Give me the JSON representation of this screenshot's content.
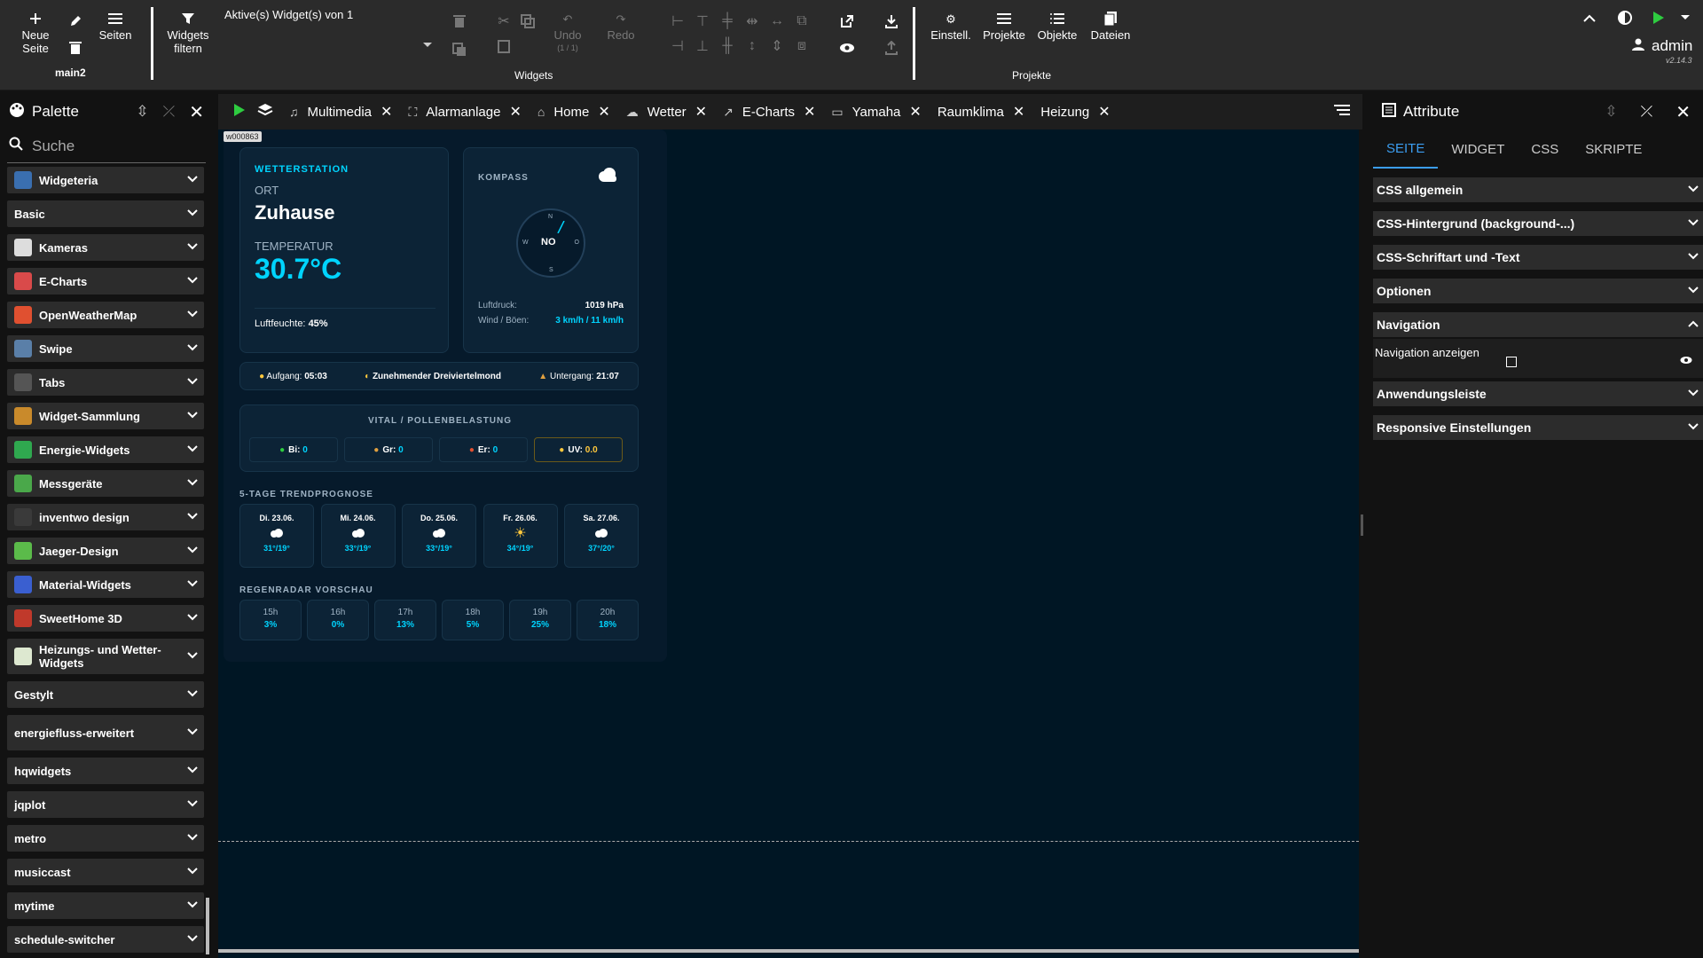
{
  "toolbar": {
    "new_page": "Neue Seite",
    "pages": "Seiten",
    "page_name": "main2",
    "widgets_filter": "Widgets filtern",
    "active_widgets": "Aktive(s) Widget(s) von 1",
    "undo": "Undo",
    "undo_count": "(1 / 1)",
    "redo": "Redo",
    "widgets_group": "Widgets",
    "settings": "Einstell.",
    "projects": "Projekte",
    "objects": "Objekte",
    "files": "Dateien",
    "projects_group": "Projekte",
    "user": "admin",
    "version": "v2.14.3"
  },
  "palette": {
    "title": "Palette",
    "search_placeholder": "Suche",
    "items": [
      {
        "label": "Widgeteria",
        "color": "#3a6fb0"
      },
      {
        "label": "Basic",
        "color": ""
      },
      {
        "label": "Kameras",
        "color": "#dddddd"
      },
      {
        "label": "E-Charts",
        "color": "#d94a4a"
      },
      {
        "label": "OpenWeatherMap",
        "color": "#e05030"
      },
      {
        "label": "Swipe",
        "color": "#5a7fa8"
      },
      {
        "label": "Tabs",
        "color": "#555555"
      },
      {
        "label": "Widget-Sammlung",
        "color": "#c98a2b"
      },
      {
        "label": "Energie-Widgets",
        "color": "#2fa84f"
      },
      {
        "label": "Messgeräte",
        "color": "#4aa84a"
      },
      {
        "label": "inventwo design",
        "color": "#3a3a3a"
      },
      {
        "label": "Jaeger-Design",
        "color": "#5bbb4a"
      },
      {
        "label": "Material-Widgets",
        "color": "#3a5fd0"
      },
      {
        "label": "SweetHome 3D",
        "color": "#c0392b"
      },
      {
        "label": "Heizungs- und Wetter-Widgets",
        "color": "#dde8d0"
      },
      {
        "label": "Gestylt",
        "color": ""
      },
      {
        "label": "energiefluss-erweitert",
        "color": ""
      },
      {
        "label": "hqwidgets",
        "color": ""
      },
      {
        "label": "jqplot",
        "color": ""
      },
      {
        "label": "metro",
        "color": ""
      },
      {
        "label": "musiccast",
        "color": ""
      },
      {
        "label": "mytime",
        "color": ""
      },
      {
        "label": "schedule-switcher",
        "color": ""
      }
    ]
  },
  "tabs": [
    "Multimedia",
    "Alarmanlage",
    "Home",
    "Wetter",
    "E-Charts",
    "Yamaha",
    "Raumklima",
    "Heizung"
  ],
  "canvas": {
    "widget_id": "w000863"
  },
  "weather": {
    "station_label": "WETTERSTATION",
    "ort_label": "ORT",
    "location": "Zuhause",
    "temp_label": "TEMPERATUR",
    "temperature": "30.7°C",
    "humidity_label": "Luftfeuchte:",
    "humidity": "45%",
    "compass_label": "KOMPASS",
    "compass": {
      "n": "N",
      "o": "O",
      "s": "S",
      "w": "W",
      "dir": "NO"
    },
    "pressure_label": "Luftdruck:",
    "pressure": "1019 hPa",
    "wind_label": "Wind / Böen:",
    "wind": "3 km/h / 11 km/h",
    "sunrise_label": "Aufgang:",
    "sunrise": "05:03",
    "moon": "Zunehmender Dreiviertelmond",
    "sunset_label": "Untergang:",
    "sunset": "21:07",
    "vital_title": "VITAL / POLLENBELASTUNG",
    "vital": [
      {
        "label": "Bi:",
        "value": "0"
      },
      {
        "label": "Gr:",
        "value": "0"
      },
      {
        "label": "Er:",
        "value": "0"
      },
      {
        "label": "UV:",
        "value": "0.0"
      }
    ],
    "forecast_title": "5-TAGE TRENDPROGNOSE",
    "forecast": [
      {
        "day": "Di. 23.06.",
        "temp": "31°/19°",
        "icon": "cloud-icon"
      },
      {
        "day": "Mi. 24.06.",
        "temp": "33°/19°",
        "icon": "cloud-icon"
      },
      {
        "day": "Do. 25.06.",
        "temp": "33°/19°",
        "icon": "cloud-icon"
      },
      {
        "day": "Fr. 26.06.",
        "temp": "34°/19°",
        "icon": "sun-icon"
      },
      {
        "day": "Sa. 27.06.",
        "temp": "37°/20°",
        "icon": "cloud-icon"
      }
    ],
    "radar_title": "REGENRADAR VORSCHAU",
    "radar": [
      {
        "hour": "15h",
        "value": "3%"
      },
      {
        "hour": "16h",
        "value": "0%"
      },
      {
        "hour": "17h",
        "value": "13%"
      },
      {
        "hour": "18h",
        "value": "5%"
      },
      {
        "hour": "19h",
        "value": "25%"
      },
      {
        "hour": "20h",
        "value": "18%"
      }
    ]
  },
  "attributes": {
    "title": "Attribute",
    "tabs": [
      "SEITE",
      "WIDGET",
      "CSS",
      "SKRIPTE"
    ],
    "sections": [
      "CSS allgemein",
      "CSS-Hintergrund (background-...)",
      "CSS-Schriftart und -Text",
      "Optionen",
      "Navigation",
      "Anwendungsleiste",
      "Responsive Einstellungen"
    ],
    "nav_show_label": "Navigation anzeigen"
  },
  "colors": {
    "accent": "#00d4ff",
    "tab_active": "#3b9df0",
    "canvas_bg": "#001624",
    "uv": "#ffc83d"
  }
}
